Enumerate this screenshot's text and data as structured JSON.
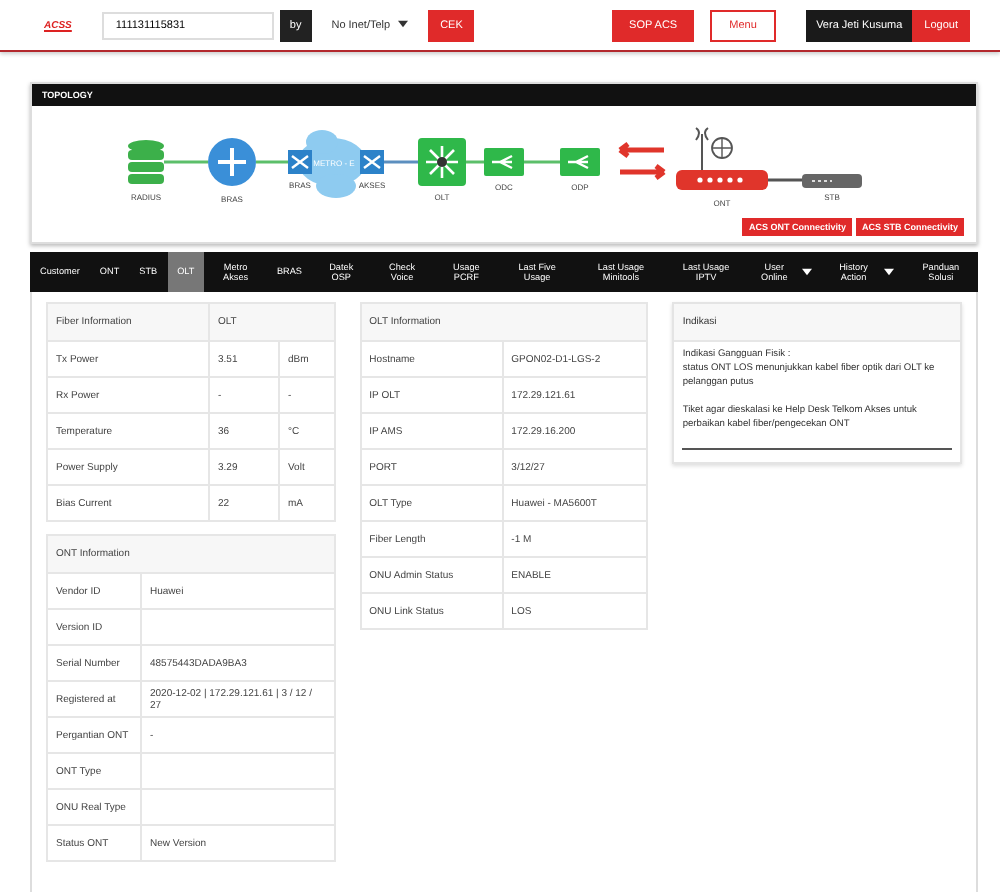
{
  "header": {
    "logo": "ACSS",
    "search_value": "111131115831",
    "by_label": "by",
    "search_type": "No Inet/Telp",
    "check_button": "CEK",
    "sop_button": "SOP ACS",
    "menu_button": "Menu",
    "user_name": "Vera Jeti Kusuma",
    "logout_button": "Logout"
  },
  "topology": {
    "title": "TOPOLOGY",
    "nodes": [
      {
        "kind": "database",
        "label": "RADIUS"
      },
      {
        "kind": "router",
        "label": "BRAS"
      },
      {
        "kind": "metro",
        "label": "BRAS",
        "cloud_label": "METRO - E",
        "label_right": "AKSES"
      },
      {
        "kind": "olt",
        "label": "OLT"
      },
      {
        "kind": "splitter",
        "label": "ODC"
      },
      {
        "kind": "splitter",
        "label": "ODP"
      },
      {
        "kind": "arrows"
      },
      {
        "kind": "ont",
        "label": "ONT"
      },
      {
        "kind": "stb",
        "label": "STB"
      }
    ],
    "buttons": [
      "ACS ONT Connectivity",
      "ACS STB Connectivity"
    ]
  },
  "tabs": [
    {
      "label": "Customer",
      "selected": false
    },
    {
      "label": "ONT",
      "selected": false
    },
    {
      "label": "STB",
      "selected": false
    },
    {
      "label": "OLT",
      "selected": true
    },
    {
      "label": "Metro Akses",
      "selected": false
    },
    {
      "label": "BRAS",
      "selected": false
    },
    {
      "label": "Datek OSP",
      "selected": false
    },
    {
      "label": "Check Voice",
      "selected": false
    },
    {
      "label": "Usage PCRF",
      "selected": false
    },
    {
      "label": "Last Five Usage",
      "selected": false
    },
    {
      "label": "Last Usage Minitools",
      "selected": false
    },
    {
      "label": "Last Usage IPTV",
      "selected": false
    },
    {
      "label": "User Online",
      "selected": false,
      "dropdown": true
    },
    {
      "label": "History Action",
      "selected": false,
      "dropdown": true
    },
    {
      "label": "Panduan Solusi",
      "selected": false
    }
  ],
  "fiber_information": {
    "headers": [
      "Fiber Information",
      "OLT"
    ],
    "rows": [
      [
        "Tx Power",
        "3.51",
        "dBm"
      ],
      [
        "Rx Power",
        "-",
        "-"
      ],
      [
        "Temperature",
        "36",
        "°C"
      ],
      [
        "Power Supply",
        "3.29",
        "Volt"
      ],
      [
        "Bias Current",
        "22",
        "mA"
      ]
    ]
  },
  "ont_information": {
    "title": "ONT Information",
    "rows": [
      [
        "Vendor ID",
        "Huawei"
      ],
      [
        "Version ID",
        ""
      ],
      [
        "Serial Number",
        "48575443DADA9BA3"
      ],
      [
        "Registered at",
        "2020-12-02 | 172.29.121.61 | 3 / 12 / 27"
      ],
      [
        "Pergantian ONT",
        "-"
      ],
      [
        "ONT Type",
        ""
      ],
      [
        "ONU Real Type",
        ""
      ],
      [
        "Status ONT",
        "New Version"
      ]
    ]
  },
  "olt_information": {
    "title": "OLT Information",
    "rows": [
      [
        "Hostname",
        "GPON02-D1-LGS-2"
      ],
      [
        "IP OLT",
        "172.29.121.61"
      ],
      [
        "IP AMS",
        "172.29.16.200"
      ],
      [
        "PORT",
        "3/12/27"
      ],
      [
        "OLT Type",
        "Huawei - MA5600T"
      ],
      [
        "Fiber Length",
        "-1 M"
      ],
      [
        "ONU Admin Status",
        "ENABLE"
      ],
      [
        "ONU Link Status",
        "LOS"
      ]
    ]
  },
  "indikasi": {
    "title": "Indikasi",
    "paragraphs": [
      "Indikasi Gangguan Fisik :\nstatus ONT LOS menunjukkan kabel fiber optik dari OLT ke pelanggan putus",
      "Tiket agar dieskalasi ke Help Desk Telkom Akses untuk perbaikan kabel fiber/pengecekan ONT"
    ]
  }
}
